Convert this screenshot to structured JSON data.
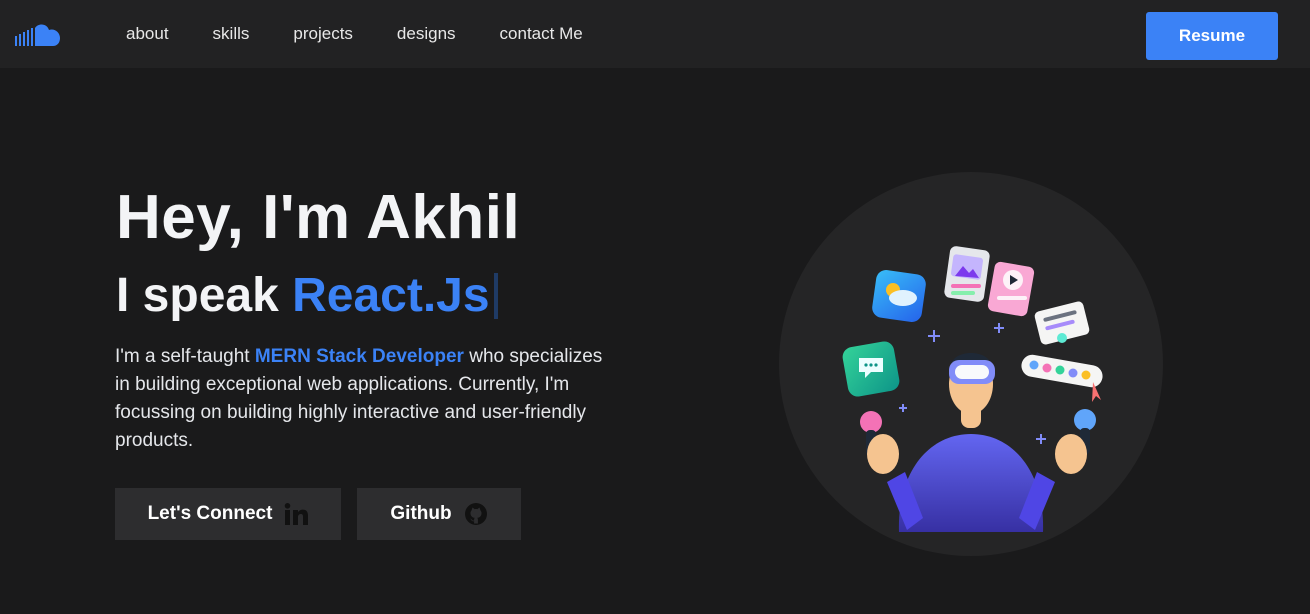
{
  "nav": {
    "logo_icon": "cloud-logo-icon",
    "links": [
      "about",
      "skills",
      "projects",
      "designs",
      "contact Me"
    ],
    "resume_label": "Resume"
  },
  "hero": {
    "greeting": "Hey, I'm Akhil",
    "speak_prefix": "I speak ",
    "speak_tech": "React.Js",
    "desc_prefix": "I'm a self-taught ",
    "desc_highlight": "MERN Stack Developer",
    "desc_suffix": " who specializes in building exceptional web applications. Currently, I'm focussing on building highly interactive and user-friendly products.",
    "connect_label": "Let's Connect",
    "connect_icon": "linkedin-icon",
    "github_label": "Github",
    "github_icon": "github-icon",
    "illustration": "vr-developer-illustration"
  },
  "colors": {
    "accent": "#3b82f6",
    "background": "#1a1a1b",
    "navbar": "#222223",
    "button": "#2d2d2f"
  }
}
